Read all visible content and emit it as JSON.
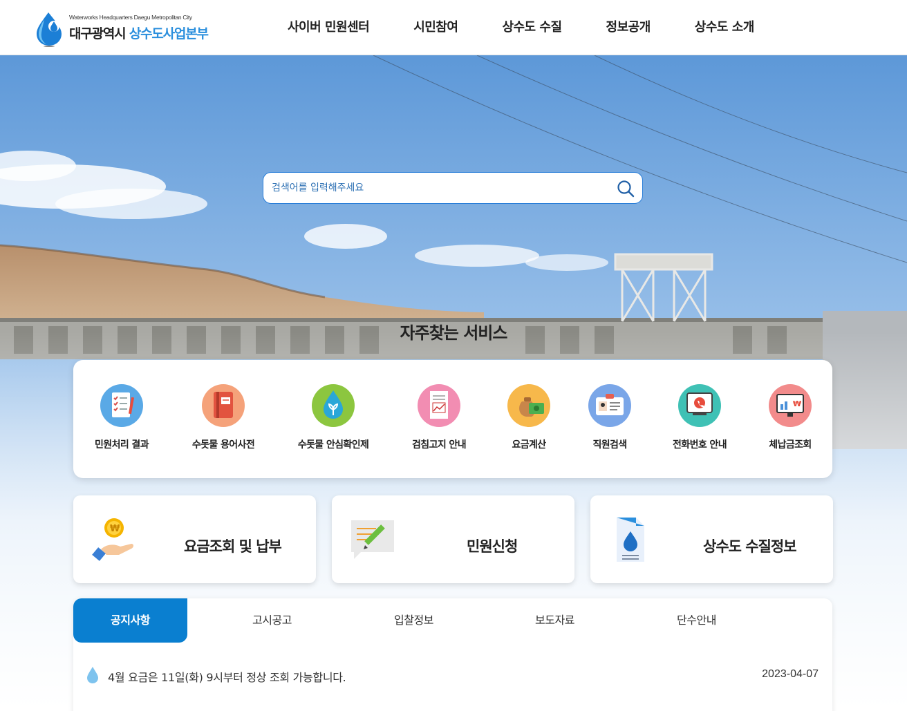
{
  "header": {
    "logo_en": "Waterworks Headquarters Daegu Metropolitan City",
    "logo_ko_part1": "대구광역시",
    "logo_ko_part2": "상수도사업본부",
    "nav": [
      "사이버 민원센터",
      "시민참여",
      "상수도 수질",
      "정보공개",
      "상수도 소개"
    ]
  },
  "search": {
    "placeholder": "검색어를 입력해주세요"
  },
  "favorites": {
    "title": "자주찾는 서비스",
    "items": [
      {
        "label": "민원처리 결과",
        "icon": "checklist-icon",
        "color": "#5aa9e6"
      },
      {
        "label": "수돗물 용어사전",
        "icon": "book-icon",
        "color": "#f08a5d"
      },
      {
        "label": "수돗물 안심확인제",
        "icon": "water-drop-icon",
        "color": "#8cc63f"
      },
      {
        "label": "검침고지 안내",
        "icon": "receipt-icon",
        "color": "#f28db2"
      },
      {
        "label": "요금계산",
        "icon": "money-bag-icon",
        "color": "#f7b84b"
      },
      {
        "label": "직원검색",
        "icon": "id-card-icon",
        "color": "#7aa6e8"
      },
      {
        "label": "전화번호 안내",
        "icon": "phone-icon",
        "color": "#3fc1b5"
      },
      {
        "label": "체납금조회",
        "icon": "bill-chart-icon",
        "color": "#f28b8b"
      }
    ]
  },
  "cards": [
    {
      "label": "요금조회 및 납부",
      "icon": "coin-hand-icon"
    },
    {
      "label": "민원신청",
      "icon": "memo-pencil-icon"
    },
    {
      "label": "상수도 수질정보",
      "icon": "water-report-icon"
    }
  ],
  "board": {
    "tabs": [
      "공지사항",
      "고시공고",
      "입찰정보",
      "보도자료",
      "단수안내"
    ],
    "active_tab": "공지사항",
    "notices": [
      {
        "text": "4월 요금은 11일(화) 9시부터 정상 조회 가능합니다.",
        "date": "2023-04-07"
      }
    ]
  },
  "colors": {
    "accent": "#0a7fd0",
    "brand_blue": "#2b8fdd"
  }
}
